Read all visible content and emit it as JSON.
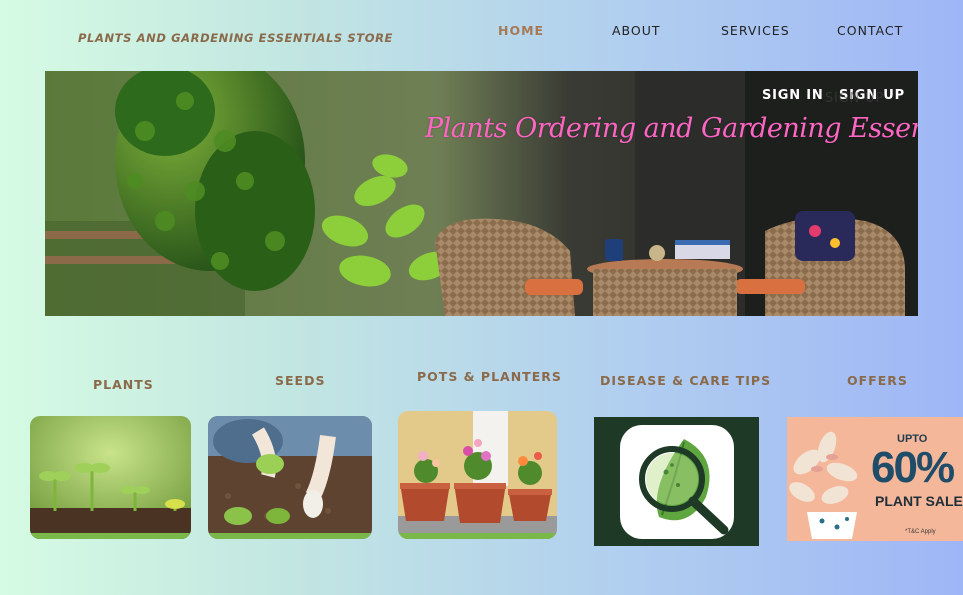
{
  "brand": "PLANTS AND GARDENING ESSENTIALS STORE",
  "nav": {
    "home": "HOME",
    "about": "ABOUT",
    "services": "SERVICES",
    "contact": "CONTACT"
  },
  "hero": {
    "title": "Plants Ordering and Gardening Essentials Store",
    "sign_in": "SIGN IN",
    "sign_up": "SIGN UP",
    "sign_up_ghost": "SIGN UP"
  },
  "categories": [
    {
      "label": "PLANTS"
    },
    {
      "label": "SEEDS"
    },
    {
      "label": "POTS & PLANTERS"
    },
    {
      "label": "DISEASE & CARE TIPS"
    },
    {
      "label": "OFFERS"
    }
  ],
  "offer": {
    "upto": "UPTO",
    "percent": "60%",
    "text": "PLANT SALE",
    "tc": "*T&C Apply"
  },
  "colors": {
    "brand_text": "#8a6a4a",
    "nav_active": "#a67a56",
    "hero_title": "#ff66c4",
    "accent_green": "#7bb84a",
    "tips_bg": "#1e3a26"
  },
  "icons": {
    "disease_care": "magnifier-leaf-icon"
  }
}
